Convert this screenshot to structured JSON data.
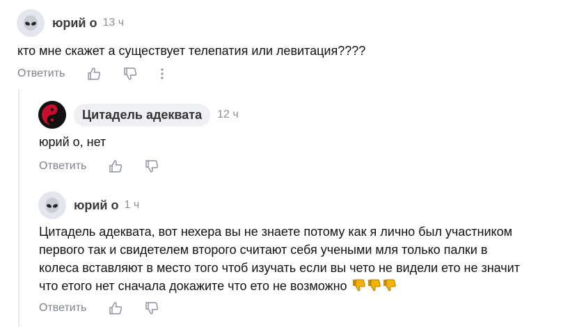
{
  "comment1": {
    "author": "юрий о",
    "time": "13 ч",
    "text": "кто мне скажет а существует телепатия или левитация????",
    "reply_label": "Ответить",
    "like_icon": "thumbs-up-icon",
    "dislike_icon": "thumbs-down-icon",
    "more_icon": "more-vertical-icon",
    "avatar_icon": "alien-icon"
  },
  "reply1": {
    "author": "Цитадель адеквата",
    "time": "12 ч",
    "text": "юрий о, нет",
    "reply_label": "Ответить",
    "avatar_icon": "yin-yang-icon"
  },
  "reply2": {
    "author": "юрий о",
    "time": "1 ч",
    "lines": [
      "Цитадель адеквата, вот нехера вы не знаете потому как я лично был участником",
      "первого так и свидетелем второго считают себя учеными мля только палки в",
      "колеса вставляют в место того чтоб изучать если вы чето не видели ето не значит",
      "что етого нет сначала докажите что ето не возможно"
    ],
    "emojis": [
      "thumbs-down-emoji",
      "thumbs-down-emoji",
      "thumbs-down-emoji"
    ],
    "reply_label": "Ответить",
    "avatar_icon": "alien-icon"
  },
  "colors": {
    "thread_line": "#e6e8ec",
    "meta_gray": "#8a8f98",
    "emoji_yellow": "#f5b301"
  }
}
